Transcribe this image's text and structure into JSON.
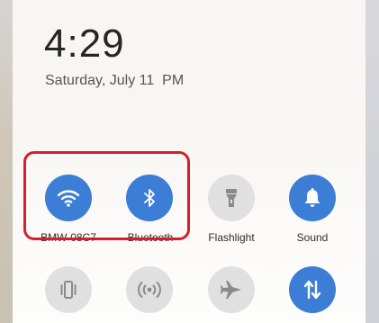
{
  "status": {
    "time": "4:29",
    "date": "Saturday, July 11  PM"
  },
  "quick_settings": {
    "row1": [
      {
        "label": "BMW-08C7",
        "icon": "wifi-icon",
        "active": true
      },
      {
        "label": "Bluetooth",
        "icon": "bluetooth-icon",
        "active": true
      },
      {
        "label": "Flashlight",
        "icon": "flashlight-icon",
        "active": false
      },
      {
        "label": "Sound",
        "icon": "bell-icon",
        "active": true
      }
    ],
    "row2": [
      {
        "icon": "vibrate-icon",
        "active": false
      },
      {
        "icon": "hotspot-icon",
        "active": false
      },
      {
        "icon": "airplane-icon",
        "active": false
      },
      {
        "icon": "mobile-data-icon",
        "active": true
      }
    ]
  },
  "colors": {
    "accent": "#3c7ed5",
    "inactive": "#e0e0e0",
    "highlight_border": "#d3202b"
  }
}
